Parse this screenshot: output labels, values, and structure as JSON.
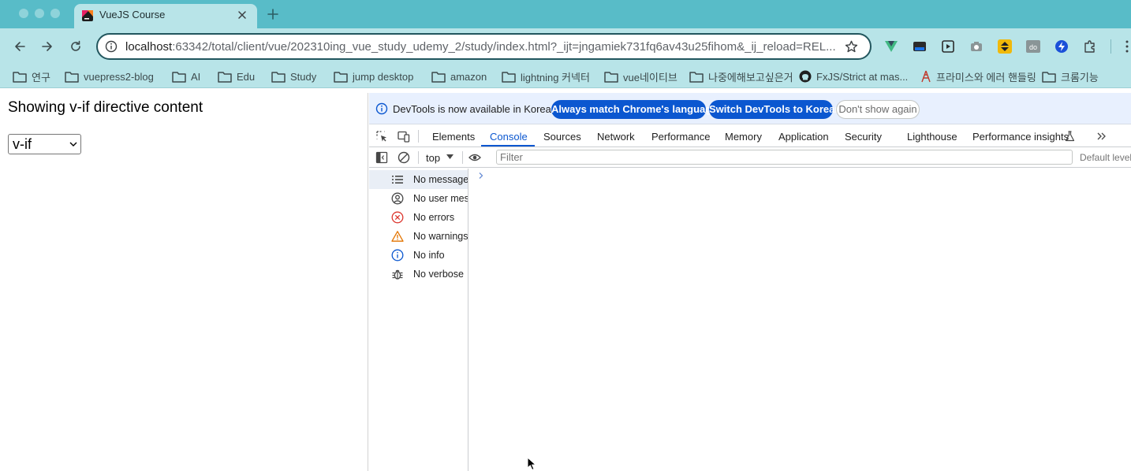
{
  "browser": {
    "tab": {
      "title": "VueJS Course"
    },
    "address": {
      "host": "localhost",
      "rest": ":63342/total/client/vue/202310ing_vue_study_udemy_2/study/index.html?_ijt=jngamiek731fq6av43u25fihom&_ij_reload=REL..."
    },
    "bookmarks": [
      {
        "label": "연구",
        "icon": "folder-icon"
      },
      {
        "label": "vuepress2-blog",
        "icon": "folder-icon"
      },
      {
        "label": "AI",
        "icon": "folder-icon"
      },
      {
        "label": "Edu",
        "icon": "folder-icon"
      },
      {
        "label": "Study",
        "icon": "folder-icon"
      },
      {
        "label": "jump desktop",
        "icon": "folder-icon"
      },
      {
        "label": "amazon",
        "icon": "folder-icon"
      },
      {
        "label": "lightning 커넥터",
        "icon": "folder-icon"
      },
      {
        "label": "vue네이티브",
        "icon": "folder-icon"
      },
      {
        "label": "나중에해보고싶은거",
        "icon": "folder-icon"
      },
      {
        "label": "FxJS/Strict at mas...",
        "icon": "github-icon"
      },
      {
        "label": "프라미스와 에러 핸들링",
        "icon": "tower-icon"
      },
      {
        "label": "크롬기능",
        "icon": "folder-icon"
      }
    ],
    "extension_colors": {
      "vue": "#41b883",
      "blue": "#1a73e8"
    }
  },
  "page": {
    "title": "Showing v-if directive content",
    "select_value": "v-if"
  },
  "devtools": {
    "infobar": {
      "message": "DevTools is now available in Korean!",
      "match_button": "Always match Chrome's language",
      "switch_button": "Switch DevTools to Korean",
      "dismiss_button": "Don't show again"
    },
    "tabs": [
      "Elements",
      "Console",
      "Sources",
      "Network",
      "Performance",
      "Memory",
      "Application",
      "Security",
      "Lighthouse",
      "Performance insights"
    ],
    "active_tab": "Console",
    "console": {
      "context": "top",
      "filter_placeholder": "Filter",
      "levels": "Default levels"
    },
    "sidebar": [
      {
        "label": "No messages",
        "icon": "list-icon"
      },
      {
        "label": "No user messages",
        "icon": "user-icon"
      },
      {
        "label": "No errors",
        "icon": "error-icon"
      },
      {
        "label": "No warnings",
        "icon": "warning-icon"
      },
      {
        "label": "No info",
        "icon": "info-icon"
      },
      {
        "label": "No verbose",
        "icon": "bug-icon"
      }
    ]
  }
}
